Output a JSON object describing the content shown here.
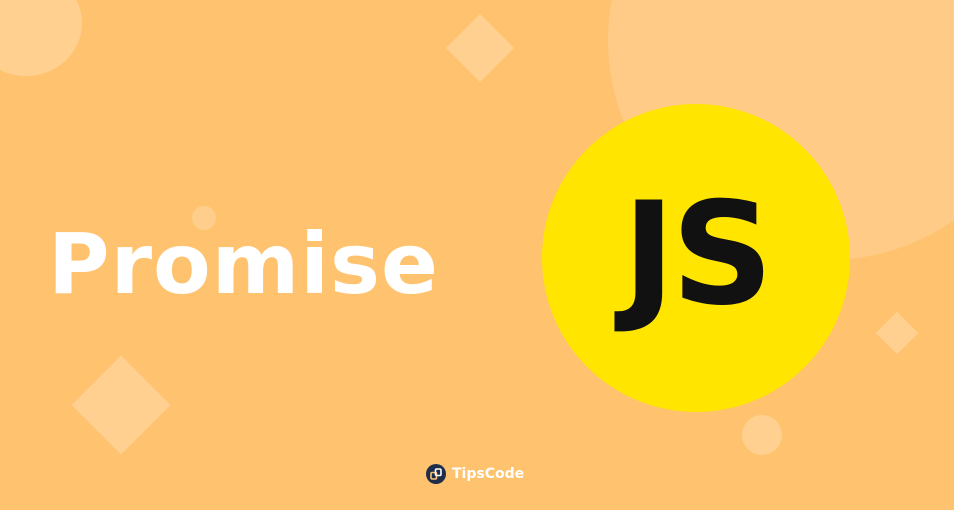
{
  "banner": {
    "title": "Promise",
    "badge_text": "JS",
    "brand_name": "TipsCode",
    "brand_icon": "tipscode-logo-icon"
  },
  "colors": {
    "background": "#FFC26F",
    "decoration": "#FFD090",
    "title_text": "#FFFFFF",
    "badge_background": "#FFE500",
    "badge_text": "#111111",
    "brand_icon": "#1E2D4A"
  }
}
